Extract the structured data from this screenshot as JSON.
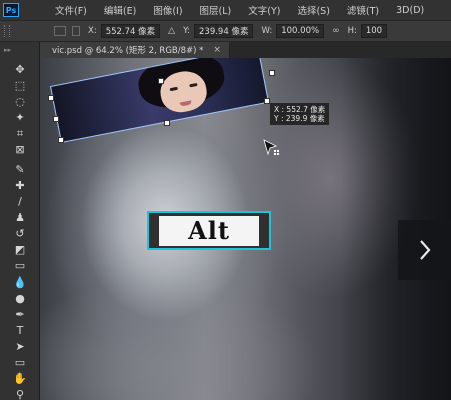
{
  "app": {
    "logo_text": "Ps"
  },
  "menu": [
    {
      "label": "文件(F)"
    },
    {
      "label": "编辑(E)"
    },
    {
      "label": "图像(I)"
    },
    {
      "label": "图层(L)"
    },
    {
      "label": "文字(Y)"
    },
    {
      "label": "选择(S)"
    },
    {
      "label": "滤镜(T)"
    },
    {
      "label": "3D(D)"
    }
  ],
  "options": {
    "x_label": "X:",
    "x_value": "552.74 像素",
    "y_label": "Y:",
    "y_value": "239.94 像素",
    "w_label": "W:",
    "w_value": "100.00%",
    "link_glyph": "∞",
    "h_label": "H:",
    "h_value": "100"
  },
  "document_tab": {
    "title": "vic.psd @ 64.2% (矩形 2, RGB/8#) *",
    "close_glyph": "×"
  },
  "transform_tooltip": {
    "x_line": "X : 552.7 像素",
    "y_line": "Y : 239.9 像素"
  },
  "key_overlay": {
    "label": "Alt"
  },
  "tools": [
    {
      "name": "move-tool",
      "glyph": "✥"
    },
    {
      "name": "marquee-tool",
      "glyph": "⬚"
    },
    {
      "name": "lasso-tool",
      "glyph": "◌"
    },
    {
      "name": "magic-wand-tool",
      "glyph": "✦"
    },
    {
      "name": "crop-tool",
      "glyph": "⌗"
    },
    {
      "name": "frame-tool",
      "glyph": "⊠"
    },
    {
      "name": "eyedropper-tool",
      "glyph": "✎"
    },
    {
      "name": "healing-brush-tool",
      "glyph": "✚"
    },
    {
      "name": "brush-tool",
      "glyph": "/"
    },
    {
      "name": "clone-stamp-tool",
      "glyph": "♟"
    },
    {
      "name": "history-brush-tool",
      "glyph": "↺"
    },
    {
      "name": "eraser-tool",
      "glyph": "◩"
    },
    {
      "name": "gradient-tool",
      "glyph": "▭"
    },
    {
      "name": "blur-tool",
      "glyph": "💧"
    },
    {
      "name": "dodge-tool",
      "glyph": "●"
    },
    {
      "name": "pen-tool",
      "glyph": "✒"
    },
    {
      "name": "type-tool",
      "glyph": "T"
    },
    {
      "name": "path-selection-tool",
      "glyph": "➤"
    },
    {
      "name": "rectangle-tool",
      "glyph": "▭"
    },
    {
      "name": "hand-tool",
      "glyph": "✋"
    },
    {
      "name": "zoom-tool",
      "glyph": "⚲"
    },
    {
      "name": "more-tools",
      "glyph": "…"
    }
  ],
  "colors": {
    "selection_outline": "#9ec6ff",
    "key_highlight": "#1ec3d6",
    "ps_blue": "#31a8ff"
  }
}
